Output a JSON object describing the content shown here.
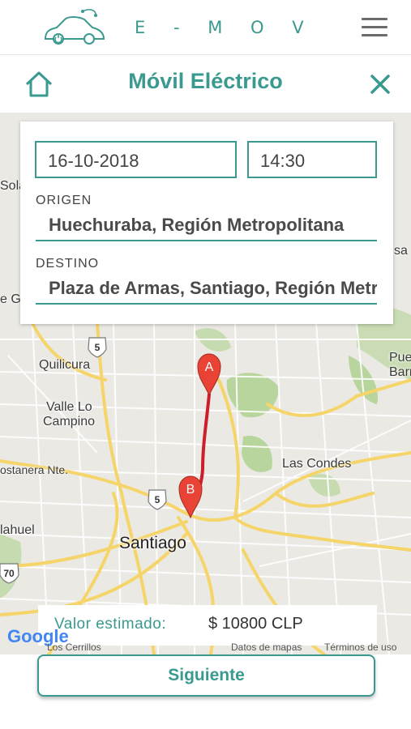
{
  "header": {
    "brand": "E - M O V",
    "logo_icon": "electric-car-icon",
    "menu_icon": "hamburger-menu-icon"
  },
  "titlebar": {
    "title": "Móvil Eléctrico",
    "home_icon": "home-icon",
    "close_icon": "close-icon"
  },
  "trip_form": {
    "date": "16-10-2018",
    "time": "14:30",
    "origin_label": "ORIGEN",
    "origin_value": "Huechuraba, Región Metropolitana",
    "destination_label": "DESTINO",
    "destination_value": "Plaza de Armas, Santiago, Región Metropolitana"
  },
  "map": {
    "labels": {
      "quilicura": "Quilicura",
      "valle_lo": "Valle Lo",
      "campino": "Campino",
      "costanera": "ostanera Nte.",
      "las_condes": "Las Condes",
      "santiago": "Santiago",
      "maipu": "lahuel",
      "sola": "Sola",
      "sa": "sa",
      "eg": "e G",
      "pue": "Pue",
      "barr": "Barr",
      "cerrillos": "Los Cerrillos"
    },
    "route_shields": [
      "5",
      "5",
      "70"
    ],
    "markers": {
      "origin": "A",
      "destination": "B"
    },
    "route_color": "#cc1f2b",
    "google": "Google",
    "attribution_data": "Datos de mapas",
    "attribution_terms": "Términos de uso"
  },
  "estimate": {
    "label": "Valor estimado:",
    "value": "$ 10800 CLP"
  },
  "actions": {
    "next_label": "Siguiente"
  },
  "colors": {
    "accent": "#3a9a8f",
    "route": "#cc1f2b"
  }
}
